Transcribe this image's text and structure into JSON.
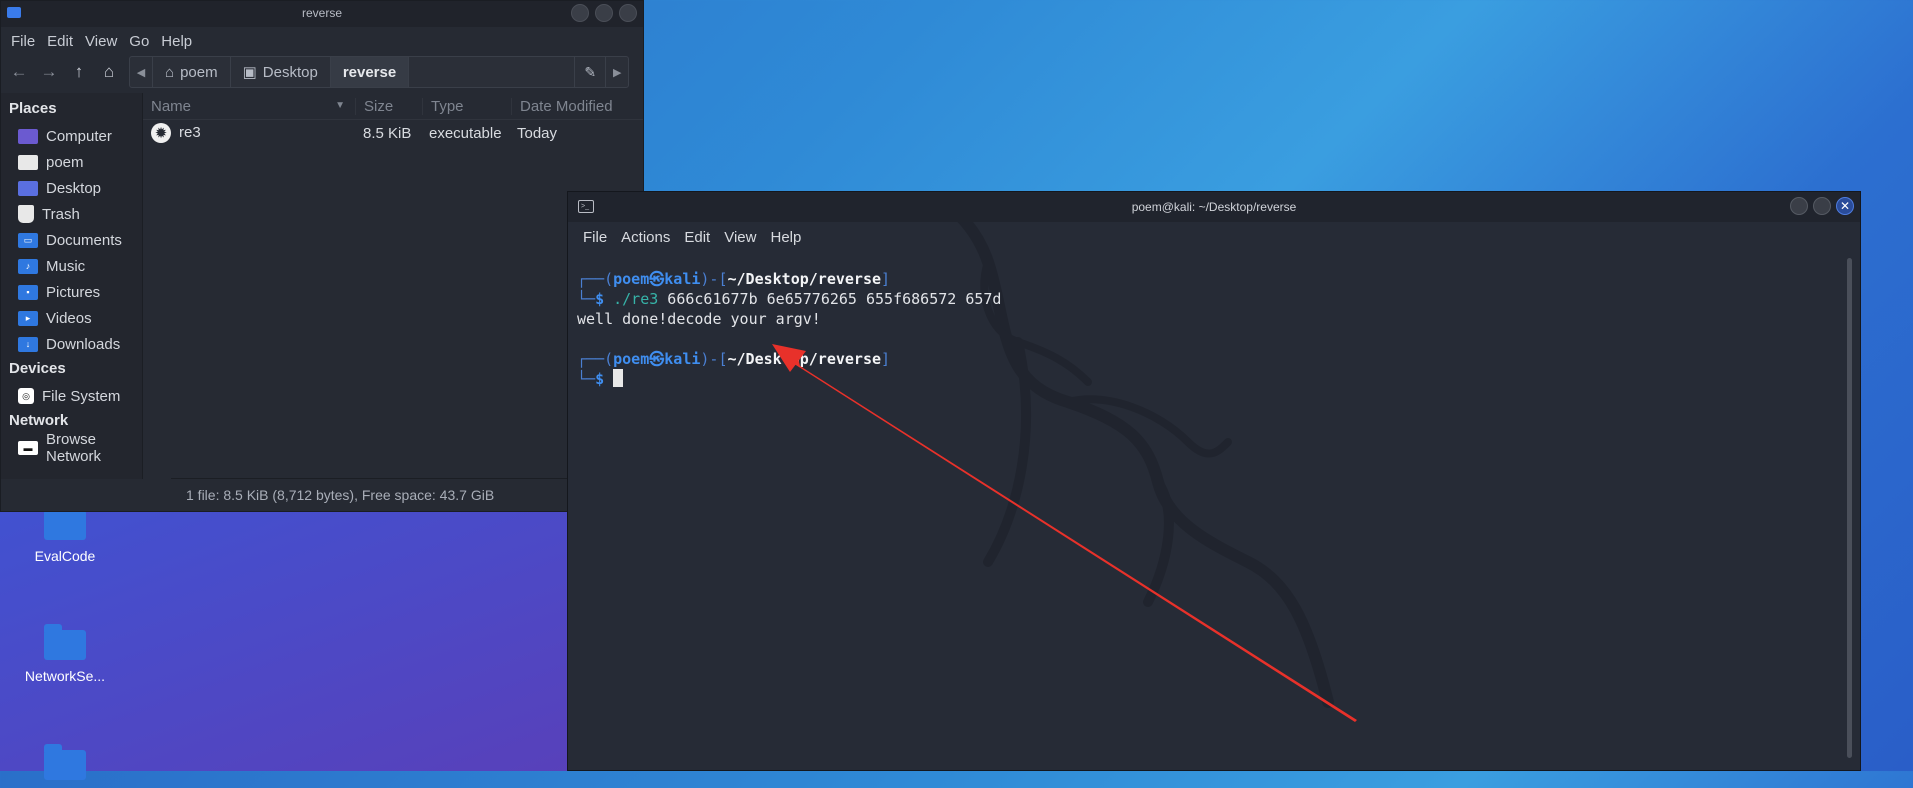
{
  "desktop": {
    "icons": [
      {
        "label": "EvalCode"
      },
      {
        "label": "NetworkSe..."
      },
      {
        "label": ""
      }
    ]
  },
  "file_manager": {
    "title": "reverse",
    "menu": [
      "File",
      "Edit",
      "View",
      "Go",
      "Help"
    ],
    "path": [
      "poem",
      "Desktop",
      "reverse"
    ],
    "sidebar": {
      "places_heading": "Places",
      "places": [
        "Computer",
        "poem",
        "Desktop",
        "Trash",
        "Documents",
        "Music",
        "Pictures",
        "Videos",
        "Downloads"
      ],
      "devices_heading": "Devices",
      "devices": [
        "File System"
      ],
      "network_heading": "Network",
      "network": [
        "Browse Network"
      ]
    },
    "columns": {
      "name": "Name",
      "size": "Size",
      "type": "Type",
      "date": "Date Modified"
    },
    "files": [
      {
        "name": "re3",
        "size": "8.5 KiB",
        "type": "executable",
        "date": "Today"
      }
    ],
    "status": "1 file: 8.5 KiB (8,712 bytes), Free space: 43.7 GiB"
  },
  "terminal": {
    "title": "poem@kali: ~/Desktop/reverse",
    "menu": [
      "File",
      "Actions",
      "Edit",
      "View",
      "Help"
    ],
    "prompt_user": "poem",
    "prompt_symbol": "㉿",
    "prompt_host": "kali",
    "prompt_path": "~/Desktop/reverse",
    "command": "./re3",
    "command_args": " 666c61677b 6e65776265 655f686572 657d",
    "output": "well done!decode your argv!"
  },
  "colors": {
    "accent_blue": "#3f8ef0",
    "arrow_red": "#e8312a",
    "cmd_teal": "#36b3a8"
  }
}
